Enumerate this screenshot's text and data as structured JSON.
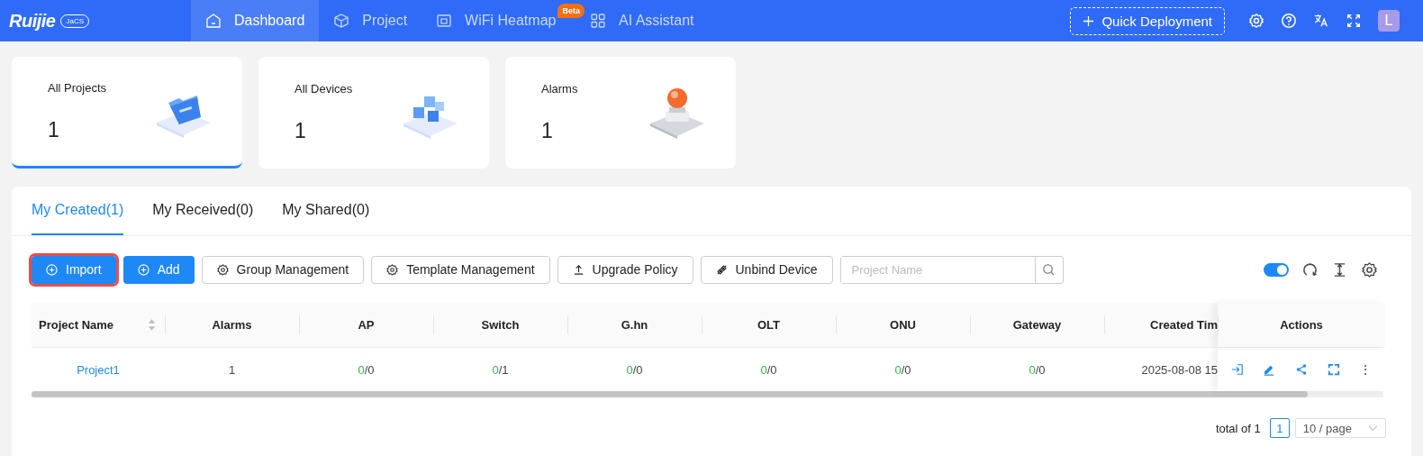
{
  "logo": {
    "brand": "Ruijie",
    "badge": "JaCS"
  },
  "nav": [
    {
      "label": "Dashboard",
      "selected": true
    },
    {
      "label": "Project",
      "selected": false
    },
    {
      "label": "WiFi Heatmap",
      "selected": false,
      "badge": "Beta"
    },
    {
      "label": "AI Assistant",
      "selected": false
    }
  ],
  "quick_deployment": "Quick Deployment",
  "avatar": "L",
  "stats": [
    {
      "label": "All Projects",
      "value": "1",
      "selected": true
    },
    {
      "label": "All Devices",
      "value": "1",
      "selected": false
    },
    {
      "label": "Alarms",
      "value": "1",
      "selected": false
    }
  ],
  "tabs": [
    {
      "label": "My Created(1)",
      "selected": true
    },
    {
      "label": "My Received(0)",
      "selected": false
    },
    {
      "label": "My Shared(0)",
      "selected": false
    }
  ],
  "toolbar": [
    {
      "label": "Import",
      "kind": "primary",
      "highlighted": true
    },
    {
      "label": "Add",
      "kind": "primary",
      "highlighted": false
    },
    {
      "label": "Group Management",
      "kind": "default",
      "highlighted": false
    },
    {
      "label": "Template Management",
      "kind": "default",
      "highlighted": false
    },
    {
      "label": "Upgrade Policy",
      "kind": "default",
      "highlighted": false
    },
    {
      "label": "Unbind Device",
      "kind": "default",
      "highlighted": false
    }
  ],
  "search": {
    "placeholder": "Project Name"
  },
  "toggle": {
    "on": true
  },
  "table": {
    "columns": [
      "Project Name",
      "Alarms",
      "AP",
      "Switch",
      "G.hn",
      "OLT",
      "ONU",
      "Gateway",
      "Created Tim",
      "Actions"
    ],
    "rows": [
      {
        "name": "Project1",
        "alarms": "1",
        "counts": [
          {
            "online": "0",
            "rest": "/0"
          },
          {
            "online": "0",
            "rest": "/1"
          },
          {
            "online": "0",
            "rest": "/0"
          },
          {
            "online": "0",
            "rest": "/0"
          },
          {
            "online": "0",
            "rest": "/0"
          },
          {
            "online": "0",
            "rest": "/0"
          }
        ],
        "created": "2025-08-08 15",
        "more": "⋮"
      }
    ]
  },
  "pagination": {
    "total": "total of 1",
    "pages": [
      {
        "label": "1",
        "selected": true
      }
    ],
    "page_size": "10 / page"
  }
}
